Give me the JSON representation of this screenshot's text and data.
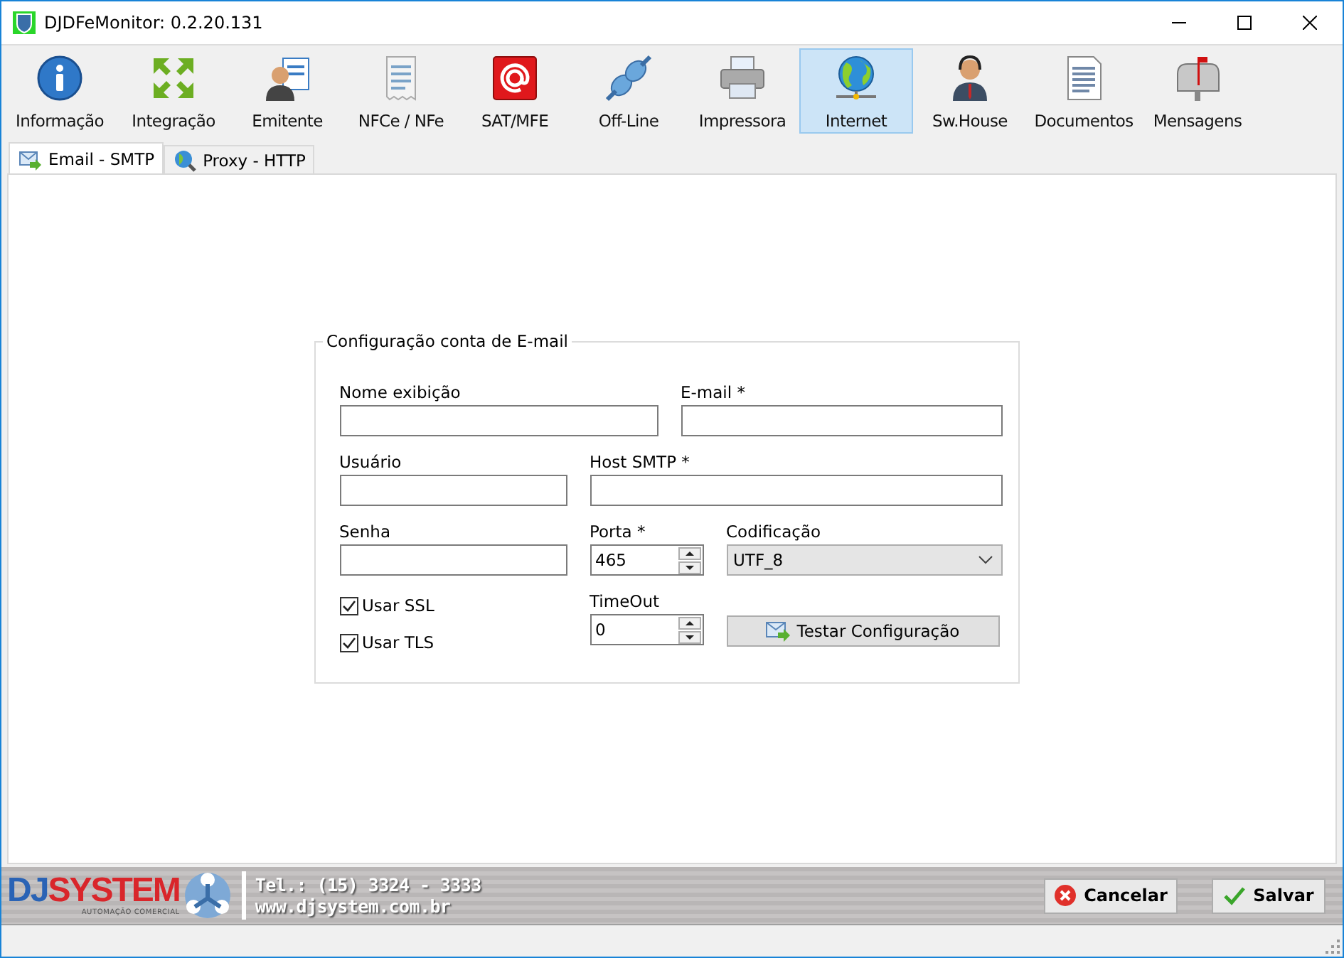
{
  "window": {
    "title": "DJDFeMonitor: 0.2.20.131"
  },
  "toolbar": [
    {
      "label": "Informação",
      "selected": false
    },
    {
      "label": "Integração",
      "selected": false
    },
    {
      "label": "Emitente",
      "selected": false
    },
    {
      "label": "NFCe / NFe",
      "selected": false
    },
    {
      "label": "SAT/MFE",
      "selected": false
    },
    {
      "label": "Off-Line",
      "selected": false
    },
    {
      "label": "Impressora",
      "selected": false
    },
    {
      "label": "Internet",
      "selected": true
    },
    {
      "label": "Sw.House",
      "selected": false
    },
    {
      "label": "Documentos",
      "selected": false
    },
    {
      "label": "Mensagens",
      "selected": false
    }
  ],
  "tabs": [
    {
      "label": "Email - SMTP",
      "selected": true
    },
    {
      "label": "Proxy - HTTP",
      "selected": false
    }
  ],
  "group": {
    "title": "Configuração conta de E-mail",
    "rows": [
      [
        {
          "kind": "text",
          "label": "Nome exibição"
        },
        {
          "kind": "text",
          "label": "E-mail *"
        }
      ],
      [
        {
          "kind": "text",
          "label": "Usuário"
        },
        {
          "kind": "text",
          "label": "Host SMTP *"
        }
      ],
      [
        {
          "kind": "text",
          "label": "Senha"
        },
        {
          "kind": "spin",
          "label": "Porta *",
          "value": "465"
        },
        {
          "kind": "select",
          "label": "Codificação",
          "value": "UTF_8"
        }
      ],
      [
        {
          "kind": "checks",
          "items": [
            {
              "label": "Usar SSL",
              "checked": true
            },
            {
              "label": "Usar TLS",
              "checked": true
            }
          ]
        },
        {
          "kind": "spin",
          "label": "TimeOut",
          "value": "0"
        },
        {
          "kind": "button",
          "label": "Testar Configuração"
        }
      ]
    ]
  },
  "footer": {
    "logo_left": "DJ",
    "logo_right": "SYSTEM",
    "logo_tagline": "AUTOMAÇÃO COMERCIAL",
    "phone": "Tel.: (15) 3324 - 3333",
    "website": "www.djsystem.com.br",
    "buttons": [
      {
        "kind": "cancel",
        "label": "Cancelar"
      },
      {
        "kind": "save",
        "label": "Salvar"
      }
    ]
  }
}
